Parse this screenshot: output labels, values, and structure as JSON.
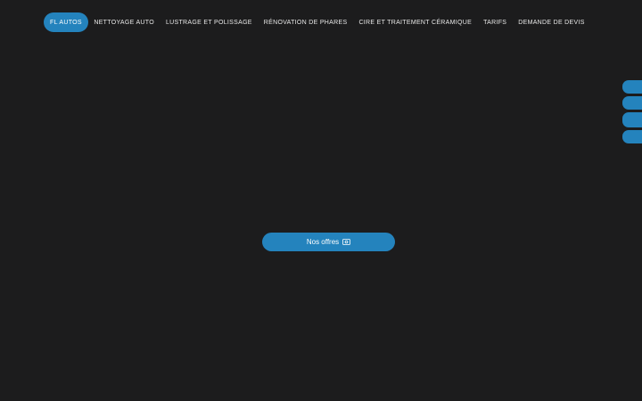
{
  "nav": {
    "items": [
      {
        "label": "FL AUTOS",
        "active": true
      },
      {
        "label": "NETTOYAGE AUTO",
        "active": false
      },
      {
        "label": "LUSTRAGE ET POLISSAGE",
        "active": false
      },
      {
        "label": "RÉNOVATION DE PHARES",
        "active": false
      },
      {
        "label": "CIRE ET TRAITEMENT CÉRAMIQUE",
        "active": false
      },
      {
        "label": "TARIFS",
        "active": false
      },
      {
        "label": "DEMANDE DE DEVIS",
        "active": false
      }
    ]
  },
  "hero": {
    "cta_label": "Nos offres",
    "cta_icon": "money-icon"
  },
  "side_buttons": {
    "count": 4
  },
  "colors": {
    "background": "#1c1c1d",
    "accent": "#2483bd",
    "text": "#e8e8e8"
  }
}
